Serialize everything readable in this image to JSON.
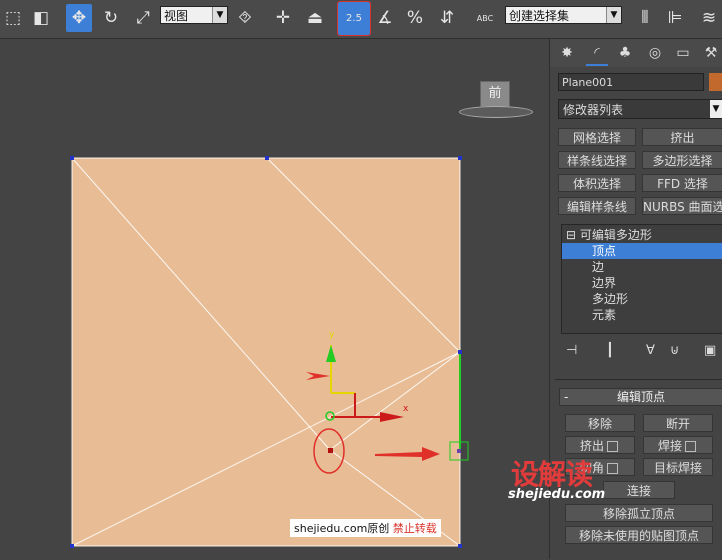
{
  "toolbar": {
    "view_dropdown": "视图",
    "snap_value": "2.5",
    "percent_symbol": "%",
    "abc_label": "ABC",
    "selection_set_dropdown": "创建选择集"
  },
  "viewport": {
    "viewcube_label": "前",
    "gizmo_y_label": "y",
    "gizmo_x_label": "x"
  },
  "panel": {
    "object_name": "Plane001",
    "modifier_list": "修改器列表",
    "modifier_buttons": [
      "网格选择",
      "挤出",
      "样条线选择",
      "多边形选择",
      "体积选择",
      "FFD 选择",
      "编辑样条线",
      "NURBS 曲面选择"
    ],
    "stack": {
      "root": "可编辑多边形",
      "items": [
        "顶点",
        "边",
        "边界",
        "多边形",
        "元素"
      ],
      "selected": "顶点"
    },
    "rollout": {
      "title": "编辑顶点",
      "collapse_symbol": "-",
      "remove": "移除",
      "break": "断开",
      "extrude": "挤出",
      "weld": "焊接",
      "chamfer": "切角",
      "target_weld": "目标焊接",
      "connect": "连接",
      "remove_isolated": "移除孤立顶点",
      "remove_unused_map": "移除未使用的贴图顶点"
    }
  },
  "watermark": {
    "brand": "设解读",
    "url": "shejiedu.com",
    "credit_prefix": "shejiedu.com原创",
    "credit_warning": "禁止转载"
  },
  "colors": {
    "plane": "#e8bc94",
    "selection_blue": "#3d7fd6",
    "annotation_red": "#e0302a",
    "gizmo_green": "#22cc22",
    "gizmo_yellow": "#e6d600",
    "gizmo_red": "#cc1a1a"
  }
}
